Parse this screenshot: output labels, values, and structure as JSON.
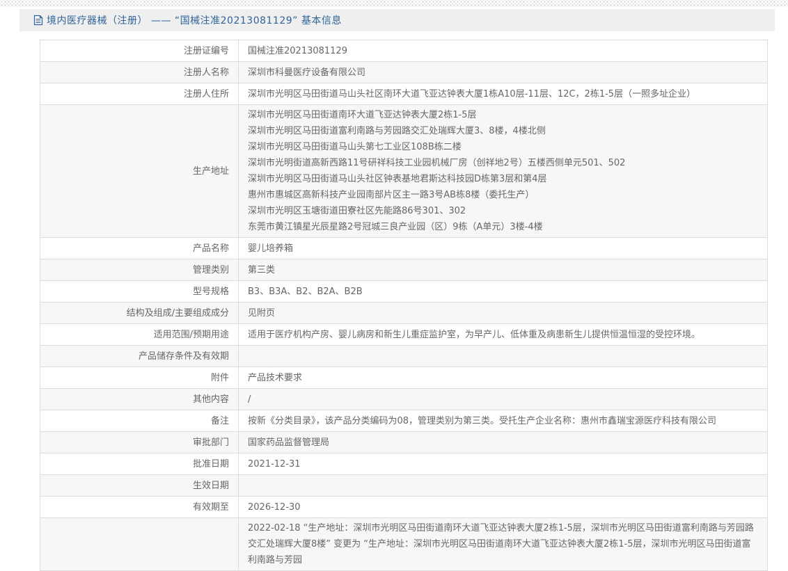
{
  "page": {
    "title": "境内医疗器械（注册） —— “国械注准20213081129” 基本信息"
  },
  "colors": {
    "accent": "#2e6399",
    "header_bg": "#efefef",
    "border": "#dcdcdc",
    "row_alt": "#f7f7f7",
    "text": "#666666"
  },
  "table": {
    "rows": [
      {
        "label": "注册证编号",
        "value": "国械注准20213081129"
      },
      {
        "label": "注册人名称",
        "value": "深圳市科曼医疗设备有限公司"
      },
      {
        "label": "注册人住所",
        "value": "深圳市光明区马田街道马山头社区南环大道飞亚达钟表大厦1栋A10层-11层、12C，2栋1-5层（一照多址企业）"
      },
      {
        "label": "生产地址",
        "lines": [
          "深圳市光明区马田街道南环大道飞亚达钟表大厦2栋1-5层",
          "深圳市光明区马田街道富利南路与芳园路交汇处瑞辉大厦3、8楼，4楼北侧",
          "深圳市光明区马田街道马山头第七工业区108B栋二楼",
          "深圳市光明街道高新西路11号研祥科技工业园机械厂房（创祥地2号）五楼西侧单元501、502",
          "深圳市光明区马田街道马山头社区钟表基地君斯达科技园D栋第3层和第4层",
          "惠州市惠城区高新科技产业园南部片区主一路3号AB栋8楼（委托生产）",
          "深圳市光明区玉塘街道田寮社区先能路86号301、302",
          "东莞市黄江镇星光辰星路2号冠城三良产业园（区）9栋（A单元）3楼-4楼"
        ]
      },
      {
        "label": "产品名称",
        "value": "婴儿培养箱"
      },
      {
        "label": "管理类别",
        "value": "第三类"
      },
      {
        "label": "型号规格",
        "value": "B3、B3A、B2、B2A、B2B"
      },
      {
        "label": "结构及组成/主要组成成分",
        "value": "见附页"
      },
      {
        "label": "适用范围/预期用途",
        "value": "适用于医疗机构产房、婴儿病房和新生儿重症监护室，为早产儿、低体重及病患新生儿提供恒温恒湿的受控环境。"
      },
      {
        "label": "产品储存条件及有效期",
        "value": ""
      },
      {
        "label": "附件",
        "value": "产品技术要求"
      },
      {
        "label": "其他内容",
        "value": "/"
      },
      {
        "label": "备注",
        "value": "按新《分类目录》，该产品分类编码为08，管理类别为第三类。受托生产企业名称：惠州市鑫瑞宝源医疗科技有限公司"
      },
      {
        "label": "审批部门",
        "value": "国家药品监督管理局"
      },
      {
        "label": "批准日期",
        "value": "2021-12-31"
      },
      {
        "label": "生效日期",
        "value": ""
      },
      {
        "label": "有效期至",
        "value": "2026-12-30"
      },
      {
        "label": "",
        "value": "2022-02-18  “生产地址：深圳市光明区马田街道南环大道飞亚达钟表大厦2栋1-5层，深圳市光明区马田街道富利南路与芳园路交汇处瑞辉大厦8楼” 变更为 “生产地址：深圳市光明区马田街道南环大道飞亚达钟表大厦2栋1-5层，深圳市光明区马田街道富利南路与芳园"
      }
    ]
  }
}
